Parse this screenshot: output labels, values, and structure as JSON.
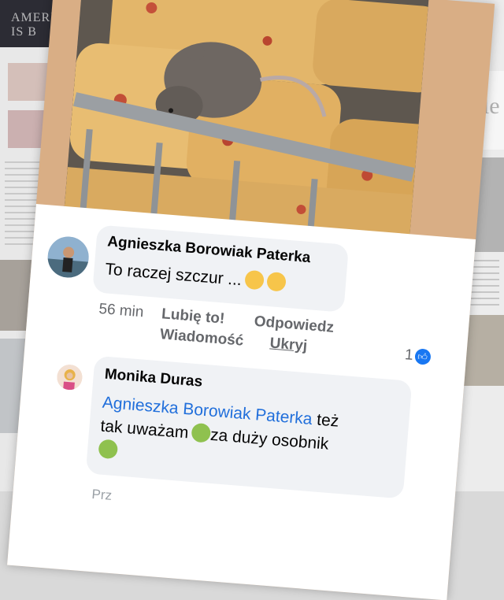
{
  "background": {
    "banner_text": "AMERICA IS B",
    "side_word": "ciele"
  },
  "comments": [
    {
      "author": "Agnieszka Borowiak Paterka",
      "text": "To raczej szczur ...",
      "time": "56 min",
      "actions": [
        "Lubię to!",
        "Odpowiedz",
        "Wiadomość",
        "Ukryj"
      ],
      "reaction_count": "1"
    },
    {
      "author": "Monika Duras",
      "mention": "Agnieszka Borowiak Paterka",
      "text_line1_after_mention": "też",
      "text_line2": "tak uważam",
      "text_line2_b": "za duży osobnik",
      "cut_off_text": "Prz"
    }
  ],
  "colors": {
    "link": "#216fdb",
    "like_blue": "#1877f2",
    "bubble": "#f0f2f5"
  }
}
